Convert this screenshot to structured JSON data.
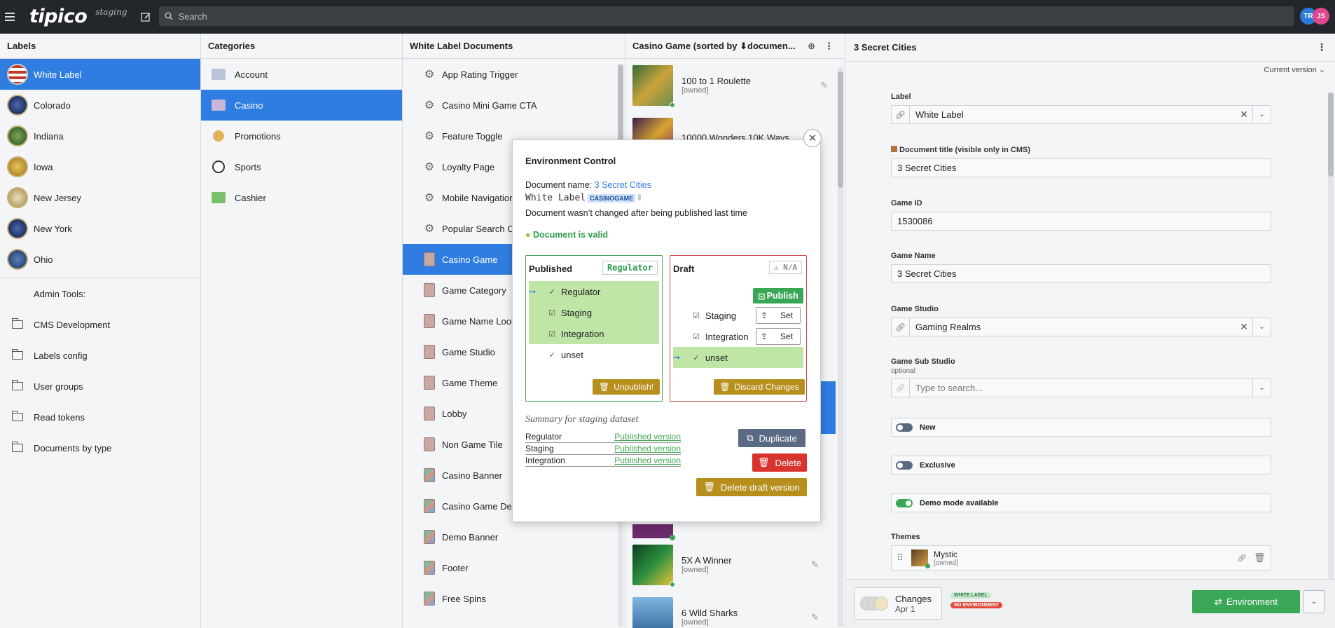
{
  "topbar": {
    "logo": "tipico",
    "env": "staging",
    "search_placeholder": "Search",
    "avatars": [
      "TR",
      "JS"
    ]
  },
  "labels": {
    "title": "Labels",
    "items": [
      "White Label",
      "Colorado",
      "Indiana",
      "Iowa",
      "New Jersey",
      "New York",
      "Ohio"
    ],
    "admin_title": "Admin Tools:",
    "admin_items": [
      "CMS Development",
      "Labels config",
      "User groups",
      "Read tokens",
      "Documents by type"
    ]
  },
  "categories": {
    "title": "Categories",
    "items": [
      "Account",
      "Casino",
      "Promotions",
      "Sports",
      "Cashier"
    ]
  },
  "documents": {
    "title": "White Label Documents",
    "items": [
      "App Rating Trigger",
      "Casino Mini Game CTA",
      "Feature Toggle",
      "Loyalty Page",
      "Mobile Navigation",
      "Popular Search Co",
      "Casino Game",
      "Game Category",
      "Game Name Looku",
      "Game Studio",
      "Game Theme",
      "Lobby",
      "Non Game Tile",
      "Casino Banner",
      "Casino Game Desc",
      "Demo Banner",
      "Footer",
      "Free Spins"
    ]
  },
  "games": {
    "title": "Casino Game (sorted by ⬇documen...",
    "items": [
      {
        "name": "100 to 1 Roulette",
        "sub": "[owned]"
      },
      {
        "name": "10000 Wonders 10K Ways",
        "sub": ""
      },
      {
        "name": "5X A Winner",
        "sub": "[owned]"
      },
      {
        "name": "6 Wild Sharks",
        "sub": "[owned]"
      }
    ]
  },
  "detail": {
    "title": "3 Secret Cities",
    "current_version": "Current version",
    "label": {
      "title": "Label",
      "value": "White Label"
    },
    "doc_title": {
      "title": "Document title (visible only in CMS)",
      "value": "3 Secret Cities"
    },
    "game_id": {
      "title": "Game ID",
      "value": "1530086"
    },
    "game_name": {
      "title": "Game Name",
      "value": "3 Secret Cities"
    },
    "game_studio": {
      "title": "Game Studio",
      "value": "Gaming Realms"
    },
    "game_sub_studio": {
      "title": "Game Sub Studio",
      "sub": "optional",
      "placeholder": "Type to search..."
    },
    "toggles": {
      "new": "New",
      "exclusive": "Exclusive",
      "demo": "Demo mode available"
    },
    "themes": {
      "title": "Themes",
      "name": "Mystic",
      "sub": "[owned]"
    }
  },
  "bottom": {
    "changes": "Changes",
    "date": "Apr 1",
    "badge_label": "WHITE LABEL",
    "badge_env": "NO ENVIRONMENT",
    "environment": "Environment"
  },
  "modal": {
    "title": "Environment Control",
    "doc_name_label": "Document name:",
    "doc_name": "3 Secret Cities",
    "label_mono": "White Label",
    "type_tag": "CASINOGAME",
    "unchanged": "Document wasn’t changed after being published last time",
    "valid": "Document is valid",
    "published": {
      "title": "Published",
      "tag": "Regulator",
      "rows": [
        "Regulator",
        "Staging",
        "Integration",
        "unset"
      ],
      "unpublish": "Unpublish!"
    },
    "draft": {
      "title": "Draft",
      "tag": "N/A",
      "publish": "Publish",
      "rows": [
        "Staging",
        "Integration",
        "unset"
      ],
      "set": "Set",
      "discard": "Discard Changes"
    },
    "summary_title": "Summary for staging dataset",
    "summary": [
      {
        "k": "Regulator",
        "v": "Published version"
      },
      {
        "k": "Staging",
        "v": "Published version"
      },
      {
        "k": "Integration",
        "v": "Published version"
      }
    ],
    "duplicate": "Duplicate",
    "delete": "Delete",
    "delete_draft": "Delete draft version"
  }
}
